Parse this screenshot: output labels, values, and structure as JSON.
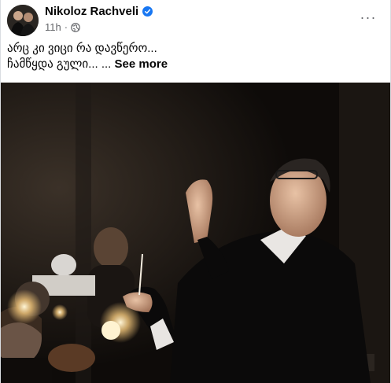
{
  "post": {
    "author": "Nikoloz Rachveli",
    "timestamp": "11h",
    "separator": "·",
    "text_line1": "არც კი ვიცი რა დავწერო...",
    "text_line2": "ჩამწყდა გული... ...",
    "see_more": "See more",
    "more_options": "···"
  },
  "icons": {
    "verified": "verified-badge-icon",
    "audience": "globe-icon",
    "menu": "more-options-icon"
  },
  "colors": {
    "verified_blue": "#1877f2",
    "meta_gray": "#65676b",
    "text": "#050505"
  }
}
